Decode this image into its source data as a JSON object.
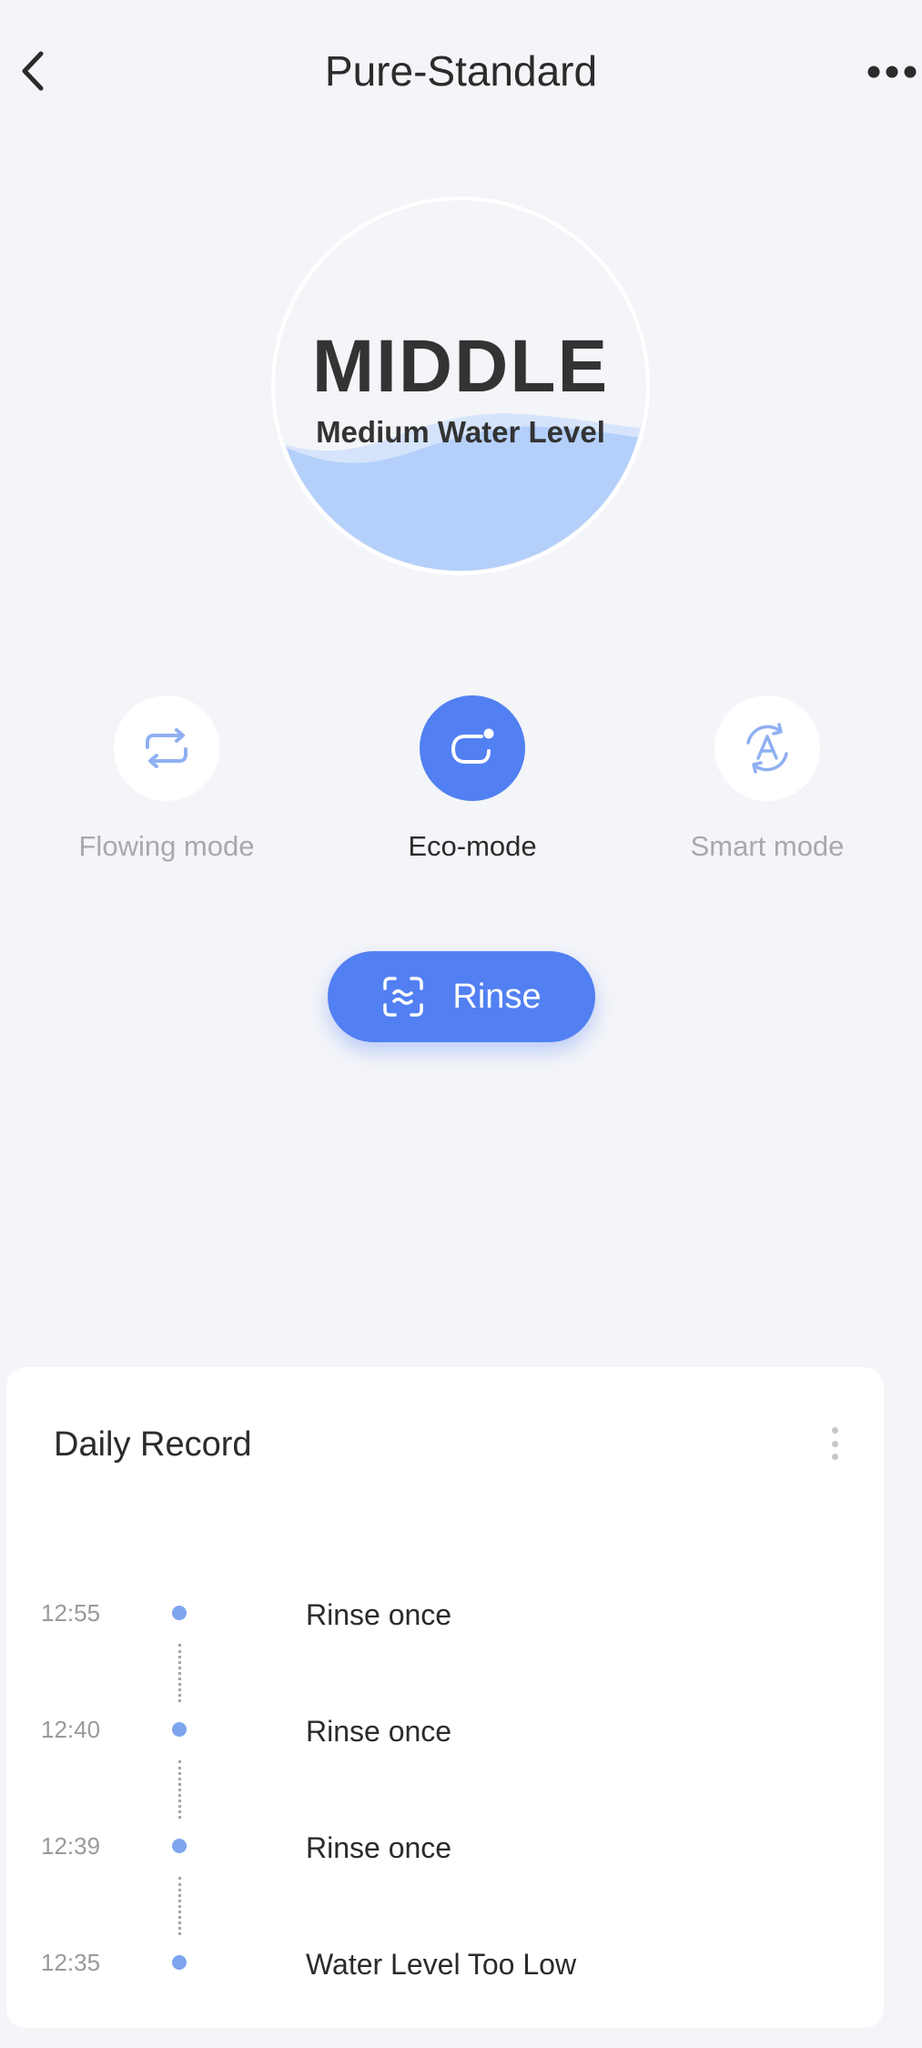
{
  "header": {
    "title": "Pure-Standard",
    "back_icon": "chevron-left-icon",
    "more_icon": "more-horizontal-icon"
  },
  "water_level": {
    "level": "MIDDLE",
    "description": "Medium Water Level",
    "fill_fraction": 0.45,
    "fill_color": "#b4d0fa"
  },
  "modes": [
    {
      "label": "Flowing mode",
      "icon": "loop-arrows-icon",
      "active": false
    },
    {
      "label": "Eco-mode",
      "icon": "eco-leaf-icon",
      "active": true
    },
    {
      "label": "Smart mode",
      "icon": "auto-a-icon",
      "active": false
    }
  ],
  "rinse_button": {
    "label": "Rinse",
    "icon": "water-wave-icon"
  },
  "daily_record": {
    "title": "Daily Record",
    "menu_icon": "more-vertical-icon",
    "entries": [
      {
        "time": "12:55",
        "text": "Rinse once"
      },
      {
        "time": "12:40",
        "text": "Rinse once"
      },
      {
        "time": "12:39",
        "text": "Rinse once"
      },
      {
        "time": "12:35",
        "text": "Water Level Too Low"
      }
    ]
  },
  "colors": {
    "accent": "#5280f2",
    "background": "#f4f5f9",
    "timeline_dot": "#7ea5ee"
  }
}
